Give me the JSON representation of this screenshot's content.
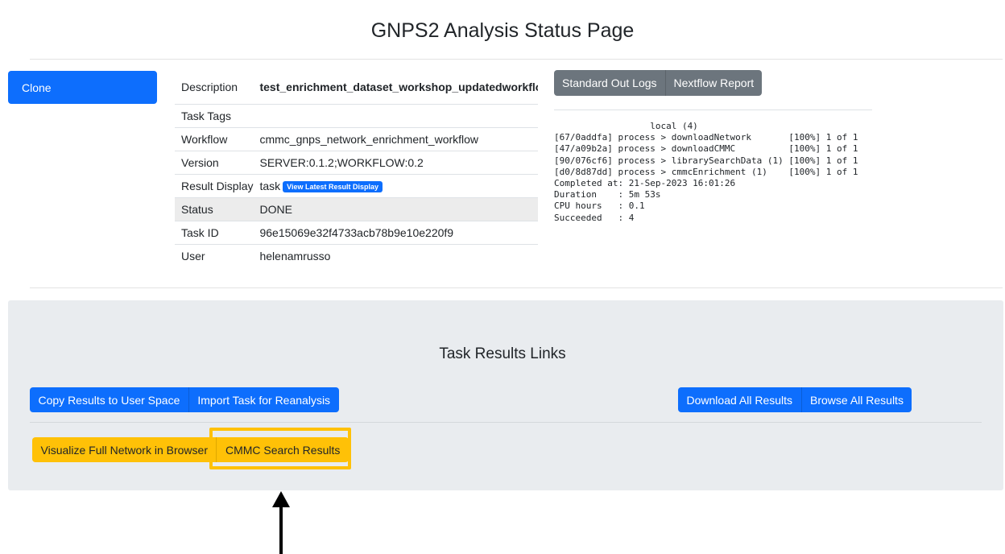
{
  "page": {
    "title": "GNPS2 Analysis Status Page"
  },
  "actions": {
    "clone_label": "Clone"
  },
  "task_info": {
    "rows": [
      {
        "label": "Description",
        "value": "test_enrichment_dataset_workshop_updatedworkflow_te"
      },
      {
        "label": "Task Tags",
        "value": ""
      },
      {
        "label": "Workflow",
        "value": "cmmc_gnps_network_enrichment_workflow"
      },
      {
        "label": "Version",
        "value": "SERVER:0.1.2;WORKFLOW:0.2"
      },
      {
        "label": "Result Display",
        "value": "task",
        "badge": "View Latest Result Display"
      },
      {
        "label": "Status",
        "value": "DONE"
      },
      {
        "label": "Task ID",
        "value": "96e15069e32f4733acb78b9e10e220f9"
      },
      {
        "label": "User",
        "value": "helenamrusso"
      }
    ]
  },
  "logs": {
    "buttons": [
      "Standard Out Logs",
      "Nextflow Report"
    ],
    "lines": [
      "                  local (4)",
      "[67/0addfa] process > downloadNetwork       [100%] 1 of 1",
      "[47/a09b2a] process > downloadCMMC          [100%] 1 of 1",
      "[90/076cf6] process > librarySearchData (1) [100%] 1 of 1",
      "[d0/8d87dd] process > cmmcEnrichment (1)    [100%] 1 of 1",
      "Completed at: 21-Sep-2023 16:01:26",
      "Duration    : 5m 53s",
      "CPU hours   : 0.1",
      "Succeeded   : 4"
    ]
  },
  "results": {
    "title": "Task Results Links",
    "left_buttons": [
      "Copy Results to User Space",
      "Import Task for Reanalysis"
    ],
    "right_buttons": [
      "Download All Results",
      "Browse All Results"
    ],
    "view_buttons": [
      "Visualize Full Network in Browser",
      "CMMC Search Results"
    ]
  },
  "colors": {
    "primary": "#0d6efd",
    "secondary": "#6c757d",
    "warning": "#ffc107",
    "panel": "#e9ecef"
  }
}
